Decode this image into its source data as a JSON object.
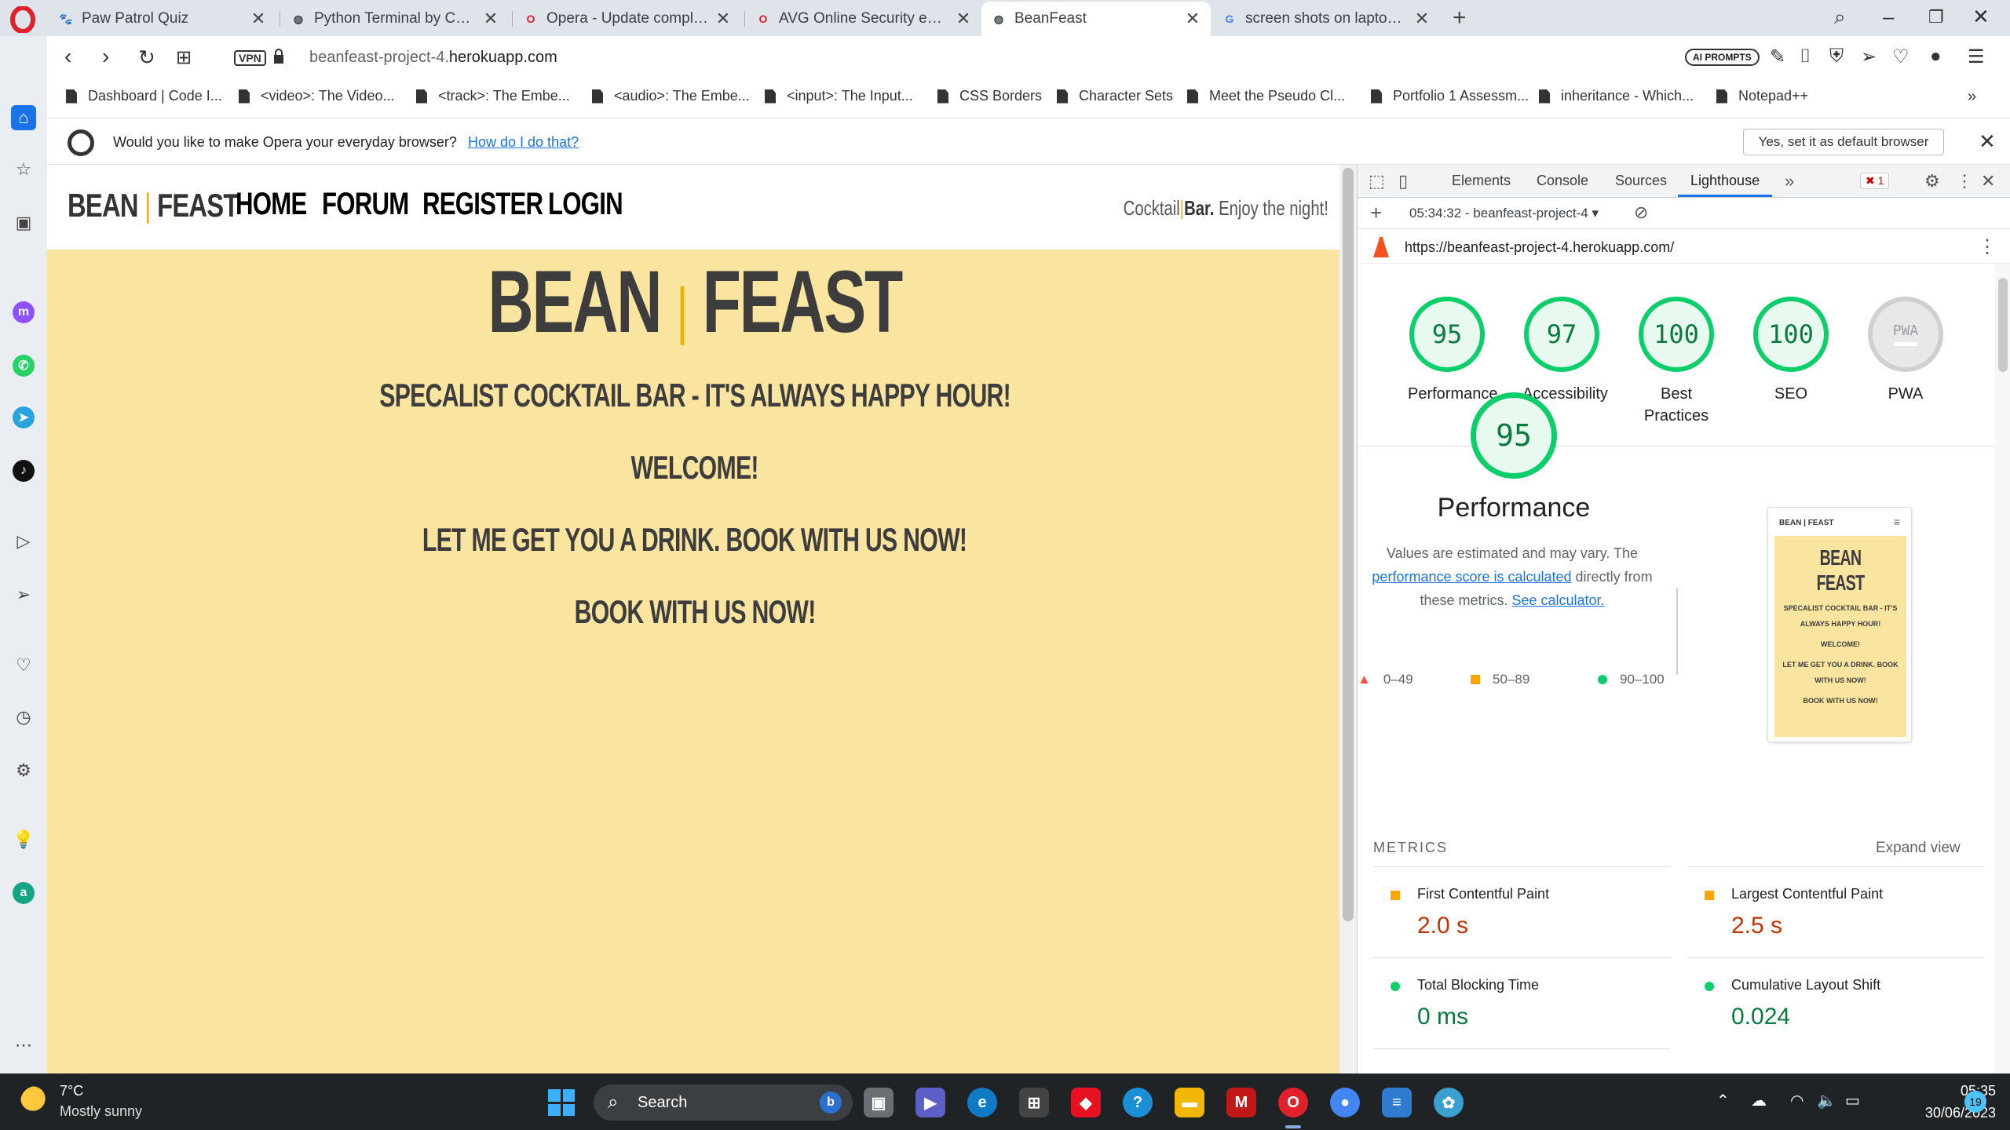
{
  "browser": {
    "tabs": [
      {
        "label": "Paw Patrol Quiz",
        "favicon": "paw-icon"
      },
      {
        "label": "Python Terminal by Code Ins",
        "favicon": "globe-icon"
      },
      {
        "label": "Opera - Update complete!",
        "favicon": "opera-icon"
      },
      {
        "label": "AVG Online Security extens",
        "favicon": "opera-icon"
      },
      {
        "label": "BeanFeast",
        "favicon": "globe-icon",
        "active": true
      },
      {
        "label": "screen shots on laptop - Go",
        "favicon": "google-icon"
      }
    ],
    "address": {
      "vpn": "VPN",
      "url_prefix": "beanfeast-project-4.",
      "url_domain": "herokuapp.com",
      "ai_prompts": "AI PROMPTS"
    },
    "bookmarks": [
      "Dashboard | Code I...",
      "<video>: The Video...",
      "<track>: The Embe...",
      "<audio>: The Embe...",
      "<input>: The Input...",
      "CSS Borders",
      "Character Sets",
      "Meet the Pseudo Cl...",
      "Portfolio 1 Assessm...",
      "inheritance - Which...",
      "Notepad++"
    ],
    "infobar": {
      "text": "Would you like to make Opera your everyday browser?",
      "link": "How do I do that?",
      "button": "Yes, set it as default browser"
    }
  },
  "site": {
    "brand_left": "BEAN",
    "brand_sep": "|",
    "brand_right": "FEAST",
    "nav": [
      "HOME",
      "FORUM",
      "REGISTER",
      "LOGIN"
    ],
    "tagline_a": "Cocktail",
    "tagline_b": "Bar.",
    "tagline_c": " Enjoy the night!",
    "hero_title_left": "BEAN",
    "hero_title_right": "FEAST",
    "lines": [
      "SPECALIST COCKTAIL BAR - IT'S ALWAYS HAPPY HOUR!",
      "WELCOME!",
      "LET ME GET YOU A DRINK. BOOK WITH US NOW!",
      "BOOK WITH US NOW!"
    ],
    "accent_color": "#f0b400",
    "background_color": "#f9e4a0"
  },
  "devtools": {
    "tabs": [
      "Elements",
      "Console",
      "Sources",
      "Lighthouse"
    ],
    "active_tab": "Lighthouse",
    "error_count": "1",
    "report": "05:34:32 - beanfeast-project-4",
    "url": "https://beanfeast-project-4.herokuapp.com/",
    "scores": [
      {
        "value": "95",
        "label": "Performance"
      },
      {
        "value": "97",
        "label": "Accessibility"
      },
      {
        "value": "100",
        "label": "Best Practices"
      },
      {
        "value": "100",
        "label": "SEO"
      },
      {
        "value": "PWA",
        "label": "PWA"
      }
    ],
    "perf": {
      "score": "95",
      "title": "Performance",
      "desc_1": "Values are estimated and may vary. The ",
      "desc_link": "performance score is calculated",
      "desc_2": " directly from these metrics. ",
      "desc_link2": "See calculator.",
      "legend": [
        "0–49",
        "50–89",
        "90–100"
      ]
    },
    "thumb": {
      "nav": "BEAN | FEAST",
      "title": "BEAN FEAST",
      "lines": [
        "SPECALIST COCKTAIL BAR - IT'S ALWAYS HAPPY HOUR!",
        "WELCOME!",
        "LET ME GET YOU A DRINK. BOOK WITH US NOW!",
        "BOOK WITH US NOW!"
      ]
    },
    "metrics_heading": "METRICS",
    "expand": "Expand view",
    "metrics": [
      {
        "name": "First Contentful Paint",
        "value": "2.0 s",
        "status": "orange"
      },
      {
        "name": "Largest Contentful Paint",
        "value": "2.5 s",
        "status": "orange"
      },
      {
        "name": "Total Blocking Time",
        "value": "0 ms",
        "status": "green"
      },
      {
        "name": "Cumulative Layout Shift",
        "value": "0.024",
        "status": "green"
      }
    ]
  },
  "taskbar": {
    "temp": "7°C",
    "weather": "Mostly sunny",
    "search": "Search",
    "time": "05:35",
    "date": "30/06/2023",
    "notifications": "19"
  }
}
